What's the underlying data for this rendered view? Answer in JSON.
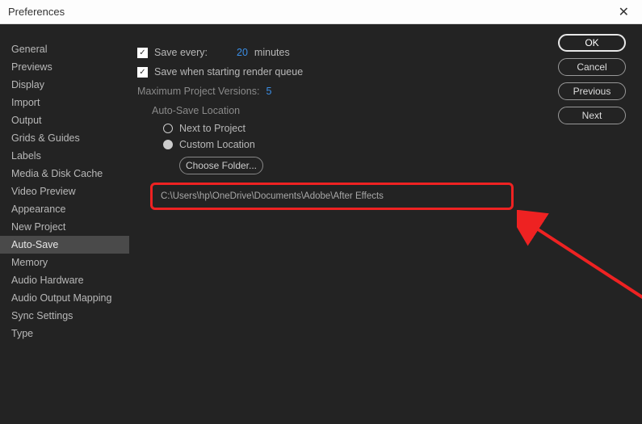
{
  "window": {
    "title": "Preferences"
  },
  "sidebar": {
    "items": [
      {
        "label": "General"
      },
      {
        "label": "Previews"
      },
      {
        "label": "Display"
      },
      {
        "label": "Import"
      },
      {
        "label": "Output"
      },
      {
        "label": "Grids & Guides"
      },
      {
        "label": "Labels"
      },
      {
        "label": "Media & Disk Cache"
      },
      {
        "label": "Video Preview"
      },
      {
        "label": "Appearance"
      },
      {
        "label": "New Project"
      },
      {
        "label": "Auto-Save"
      },
      {
        "label": "Memory"
      },
      {
        "label": "Audio Hardware"
      },
      {
        "label": "Audio Output Mapping"
      },
      {
        "label": "Sync Settings"
      },
      {
        "label": "Type"
      }
    ],
    "selected_index": 11
  },
  "buttons": {
    "ok": "OK",
    "cancel": "Cancel",
    "previous": "Previous",
    "next": "Next"
  },
  "settings": {
    "save_every_label": "Save every:",
    "save_every_value": "20",
    "save_every_unit": "minutes",
    "save_on_render_label": "Save when starting render queue",
    "max_versions_label": "Maximum Project Versions:",
    "max_versions_value": "5",
    "location_heading": "Auto-Save Location",
    "radio_next": "Next to Project",
    "radio_custom": "Custom Location",
    "choose_folder": "Choose Folder...",
    "path": "C:\\Users\\hp\\OneDrive\\Documents\\Adobe\\After Effects"
  }
}
